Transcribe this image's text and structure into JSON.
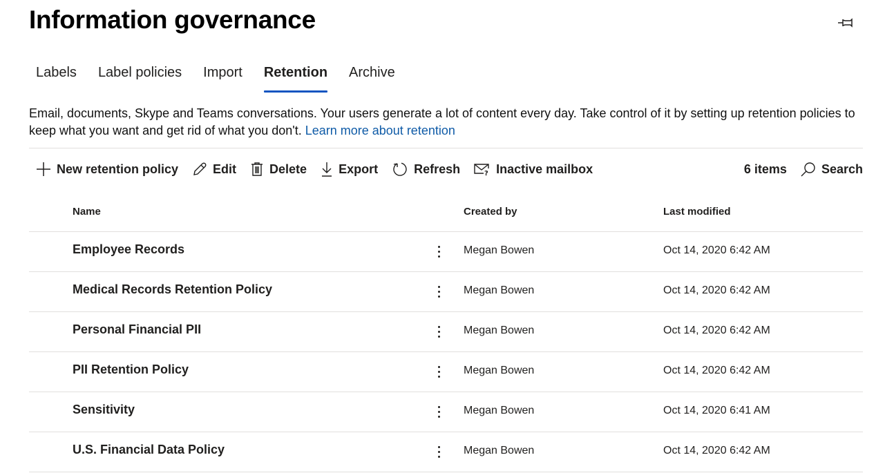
{
  "page": {
    "title": "Information governance",
    "pin_icon": "pin-icon"
  },
  "tabs": [
    {
      "label": "Labels",
      "active": false
    },
    {
      "label": "Label policies",
      "active": false
    },
    {
      "label": "Import",
      "active": false
    },
    {
      "label": "Retention",
      "active": true
    },
    {
      "label": "Archive",
      "active": false
    }
  ],
  "description": {
    "text": "Email, documents, Skype and Teams conversations. Your users generate a lot of content every day. Take control of it by setting up retention policies to keep what you want and get rid of what you don't.",
    "link": "Learn more about retention"
  },
  "toolbar": {
    "new_policy": "New retention policy",
    "edit": "Edit",
    "delete": "Delete",
    "export": "Export",
    "refresh": "Refresh",
    "inactive_mailbox": "Inactive mailbox",
    "item_count": "6 items",
    "search": "Search"
  },
  "table": {
    "columns": {
      "name": "Name",
      "created_by": "Created by",
      "last_modified": "Last modified"
    },
    "rows": [
      {
        "name": "Employee Records",
        "created_by": "Megan Bowen",
        "last_modified": "Oct 14, 2020 6:42 AM"
      },
      {
        "name": "Medical Records Retention Policy",
        "created_by": "Megan Bowen",
        "last_modified": "Oct 14, 2020 6:42 AM"
      },
      {
        "name": "Personal Financial PII",
        "created_by": "Megan Bowen",
        "last_modified": "Oct 14, 2020 6:42 AM"
      },
      {
        "name": "PII Retention Policy",
        "created_by": "Megan Bowen",
        "last_modified": "Oct 14, 2020 6:42 AM"
      },
      {
        "name": "Sensitivity",
        "created_by": "Megan Bowen",
        "last_modified": "Oct 14, 2020 6:41 AM"
      },
      {
        "name": "U.S. Financial Data Policy",
        "created_by": "Megan Bowen",
        "last_modified": "Oct 14, 2020 6:42 AM"
      }
    ]
  },
  "colors": {
    "accent": "#0f54c0",
    "link": "#0f5ba7",
    "divider": "#e1dfdd"
  }
}
